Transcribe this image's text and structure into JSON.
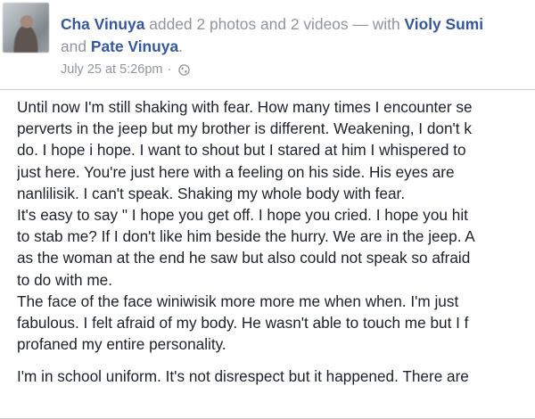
{
  "post": {
    "author": "Cha Vinuya",
    "action": "added 2 photos and 2 videos —",
    "with_word": "with",
    "tagged_1": "Violy Sumi",
    "and_word": "and",
    "tagged_2": "Pate Vinuya",
    "timestamp": "July 25 at 5:26pm",
    "separator": "·",
    "privacy_icon": "globe-icon",
    "body_lines": [
      "Until now I'm still shaking with fear. How many times I encounter se",
      "perverts in the jeep but my brother is different. Weakening, I don't k",
      "do. I hope i hope. I want to shout but I stared at him I whispered to",
      "just here. You're just here with a feeling on his side. His eyes are",
      "nanlilisik. I can't speak. Shaking my whole body with fear.",
      "It's easy to say \" I hope you get off. I hope you cried. I hope you hit",
      "to stab me? If I don't like him beside the hurry. We are in the jeep. A",
      "as the woman at the end he saw but also could not speak so afraid",
      "to do with me.",
      "The face of the face winiwisik more more me when when. I'm just",
      "fabulous. I felt afraid of my body. He wasn't able to touch me but I f",
      "profaned my entire personality.",
      "I'm in school uniform. It's not disrespect but it happened. There are"
    ]
  },
  "colors": {
    "link": "#365899",
    "meta": "#90949c",
    "text": "#1d2129",
    "border": "#cccccc"
  }
}
